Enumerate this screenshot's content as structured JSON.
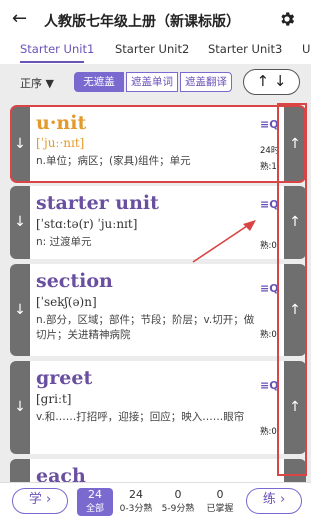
{
  "header": {
    "back_icon": "←",
    "title": "人教版七年级上册（新课标版）",
    "settings_icon": "gear-icon"
  },
  "tabs": [
    "Starter Unit1",
    "Starter Unit2",
    "Starter Unit3",
    "U"
  ],
  "filter": {
    "order_label": "正序 ▼",
    "segments": [
      "无遮盖",
      "遮盖单词",
      "遮盖翻译"
    ],
    "active_segment": "无遮盖",
    "sort_label": "↑ ↓"
  },
  "words": [
    {
      "word": "u·nit",
      "phonetic": "[ˈjuː·nɪt]",
      "meaning": "n.单位；病区；(家具)组件；单元",
      "time": "24时",
      "familiarity": "熟:1",
      "selected": true
    },
    {
      "word": "starter unit",
      "phonetic": "[ˈstɑːtə(r) ˈjuːnɪt]",
      "meaning": "n: 过渡单元",
      "familiarity": "熟:0"
    },
    {
      "word": "section",
      "phonetic": "[ˈsekʃ(ə)n]",
      "meaning": "n.部分，区域；部件；节段；阶层；v.切开；做切片；关进精神病院",
      "familiarity": "熟:0"
    },
    {
      "word": "greet",
      "phonetic": "[griːt]",
      "meaning": "v.和……打招呼，迎接；回应；映入……眼帘",
      "familiarity": "熟:0"
    },
    {
      "word": "each"
    }
  ],
  "bottom": {
    "learn_label": "学 ›",
    "practice_label": "练 ›",
    "stats": [
      {
        "count": "24",
        "label": "全部"
      },
      {
        "count": "24",
        "label": "0-3分熟"
      },
      {
        "count": "0",
        "label": "5-9分熟"
      },
      {
        "count": "0",
        "label": "已掌握"
      }
    ]
  },
  "colors": {
    "accent": "#6b52b8",
    "highlight_red": "#d94545",
    "card_side": "#6f6f6f"
  }
}
